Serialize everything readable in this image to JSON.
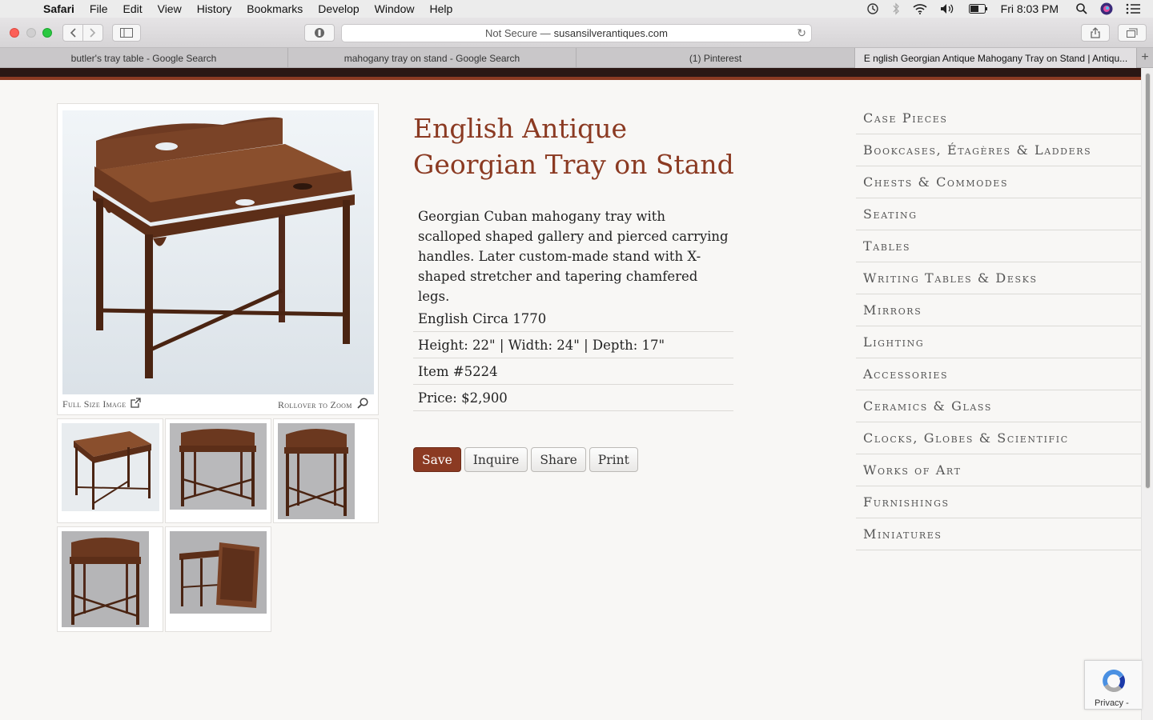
{
  "menubar": {
    "app": "Safari",
    "items": [
      "File",
      "Edit",
      "View",
      "History",
      "Bookmarks",
      "Develop",
      "Window",
      "Help"
    ],
    "clock": "Fri 8:03 PM"
  },
  "toolbar": {
    "security": "Not Secure —",
    "domain": "susansilverantiques.com"
  },
  "tabs": [
    {
      "label": "butler's tray table - Google Search"
    },
    {
      "label": "mahogany tray on stand - Google Search"
    },
    {
      "label": "(1) Pinterest"
    },
    {
      "label": "E nglish Georgian Antique Mahogany Tray on Stand | Antiqu..."
    }
  ],
  "product": {
    "title_line1": "English Antique",
    "title_line2": "Georgian Tray on Stand",
    "description": "Georgian Cuban mahogany tray with scalloped shaped gallery and pierced carrying handles. Later custom-made stand with X-shaped stretcher and tapering chamfered legs.",
    "origin": "English Circa 1770",
    "dimensions": "Height: 22\" | Width: 24\" | Depth: 17\"",
    "item_number": "Item #5224",
    "price": "Price: $2,900",
    "full_size_link": "Full Size Image",
    "zoom_hint": "Rollover to Zoom"
  },
  "actions": {
    "save": "Save",
    "inquire": "Inquire",
    "share": "Share",
    "print": "Print"
  },
  "categories": [
    "Case Pieces",
    "Bookcases, Étagères & Ladders",
    "Chests & Commodes",
    "Seating",
    "Tables",
    "Writing Tables & Desks",
    "Mirrors",
    "Lighting",
    "Accessories",
    "Ceramics & Glass",
    "Clocks, Globes & Scientific",
    "Works of Art",
    "Furnishings",
    "Miniatures"
  ],
  "recaptcha": {
    "privacy": "Privacy -"
  }
}
